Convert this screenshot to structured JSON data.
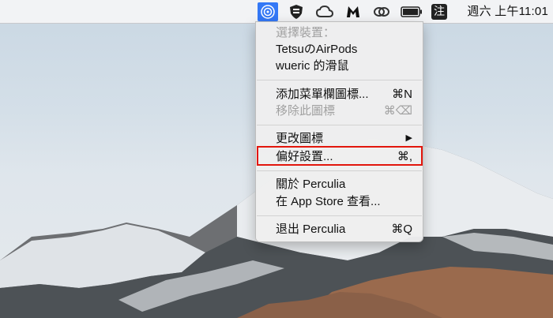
{
  "menubar": {
    "active_app_icon": "perculia-airpods-icon",
    "icons": [
      "shield-extension-icon",
      "creative-cloud-icon",
      "malwarebytes-icon",
      "linked-rings-icon",
      "battery-icon",
      "input-method-icon"
    ],
    "input_method_label": "注",
    "clock": "週六 上午11:01"
  },
  "menu": {
    "section_header": "選擇裝置：",
    "devices": [
      "TetsuのAirPods",
      "wueric 的滑鼠"
    ],
    "add_to_menubar": {
      "label": "添加菜單欄圖標...",
      "shortcut": "⌘N"
    },
    "remove_icon": {
      "label": "移除此圖標",
      "shortcut": "⌘⌫"
    },
    "change_icon": {
      "label": "更改圖標",
      "arrow": "▶"
    },
    "preferences": {
      "label": "偏好設置...",
      "shortcut": "⌘,"
    },
    "about": {
      "label": "關於 Perculia"
    },
    "app_store": {
      "label": "在 App Store 查看..."
    },
    "quit": {
      "label": "退出 Perculia",
      "shortcut": "⌘Q"
    }
  },
  "colors": {
    "accent": "#3478f6",
    "highlight_box": "#e2160c",
    "disabled_text": "#a0a0a0"
  }
}
